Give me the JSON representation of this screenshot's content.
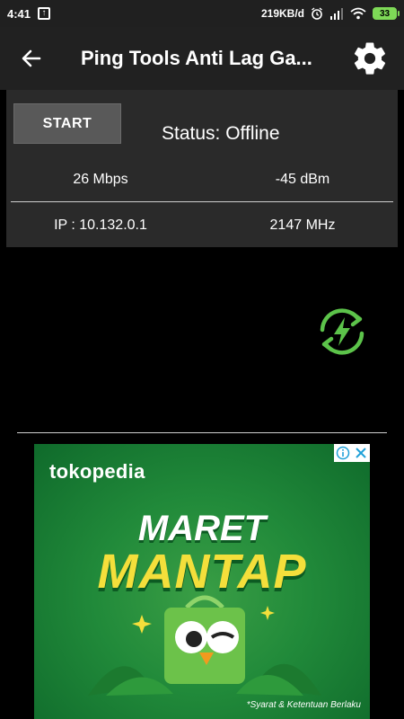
{
  "status_bar": {
    "time": "4:41",
    "net_speed": "219KB/d",
    "battery": "33",
    "notif_glyph": "↑",
    "icons": [
      "upload-notification-icon",
      "alarm-icon",
      "signal-icon",
      "wifi-icon",
      "battery-icon"
    ]
  },
  "app_bar": {
    "title": "Ping Tools Anti Lag Ga...",
    "back_icon": "arrow-left-icon",
    "settings_icon": "gear-icon"
  },
  "panel": {
    "start_label": "START",
    "status": "Status: Offline",
    "speed": "26 Mbps",
    "signal": "-45 dBm",
    "ip": "IP : 10.132.0.1",
    "frequency": "2147 MHz"
  },
  "graph": {
    "icon": "lightning-refresh-icon",
    "accent_color": "#5cc34a"
  },
  "ad": {
    "brand": "tokopedia",
    "headline1": "MARET",
    "headline2": "MANTAP",
    "disclaimer": "*Syarat & Ketentuan Berlaku",
    "controls": [
      "info-icon",
      "close-icon"
    ]
  }
}
